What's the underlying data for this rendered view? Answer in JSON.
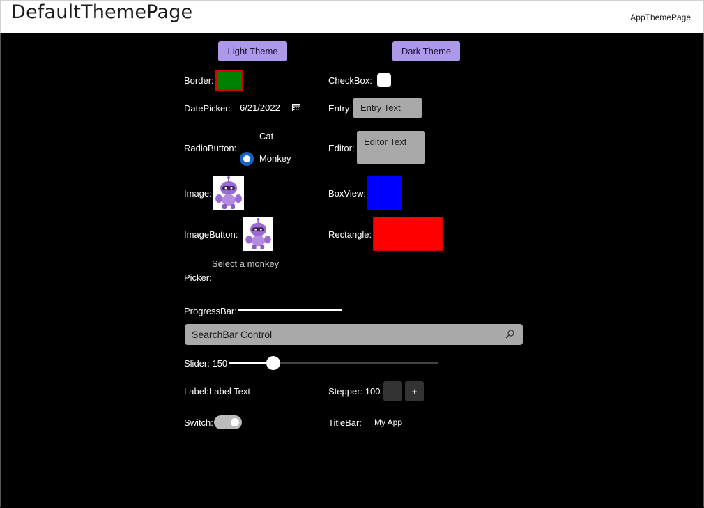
{
  "header": {
    "title": "DefaultThemePage",
    "right_label": "AppThemePage"
  },
  "theme_buttons": {
    "light": "Light Theme",
    "dark": "Dark Theme"
  },
  "border": {
    "label": "Border:"
  },
  "checkbox": {
    "label": "CheckBox:"
  },
  "datepicker": {
    "label": "DatePicker:",
    "value": "6/21/2022"
  },
  "entry": {
    "label": "Entry:",
    "value": "Entry Text"
  },
  "radio": {
    "label": "RadioButton:",
    "options": [
      "Cat",
      "Monkey"
    ],
    "selected": "Monkey"
  },
  "editor": {
    "label": "Editor:",
    "value": "Editor Text"
  },
  "image": {
    "label": "Image:"
  },
  "boxview": {
    "label": "BoxView:"
  },
  "imagebutton": {
    "label": "ImageButton:"
  },
  "rectangle": {
    "label": "Rectangle:"
  },
  "picker": {
    "label": "Picker:",
    "placeholder": "Select a monkey"
  },
  "progressbar": {
    "label": "ProgressBar:",
    "progress": 1.0
  },
  "searchbar": {
    "value": "SearchBar Control"
  },
  "slider": {
    "label": "Slider: 150",
    "value": 150,
    "fraction": 0.21
  },
  "label_ctl": {
    "label": "Label:",
    "value": "Label Text"
  },
  "stepper": {
    "label": "Stepper: 100",
    "minus": "-",
    "plus": "+"
  },
  "switch_ctl": {
    "label": "Switch:",
    "on": true
  },
  "titlebar": {
    "label": "TitleBar:",
    "value": "My App"
  },
  "colors": {
    "border_fill": "#008000",
    "border_stroke": "#e00000",
    "boxview": "#0000ff",
    "rectangle": "#ff0000",
    "button_bg": "#ac99ea",
    "radio_accent": "#1565c0"
  }
}
